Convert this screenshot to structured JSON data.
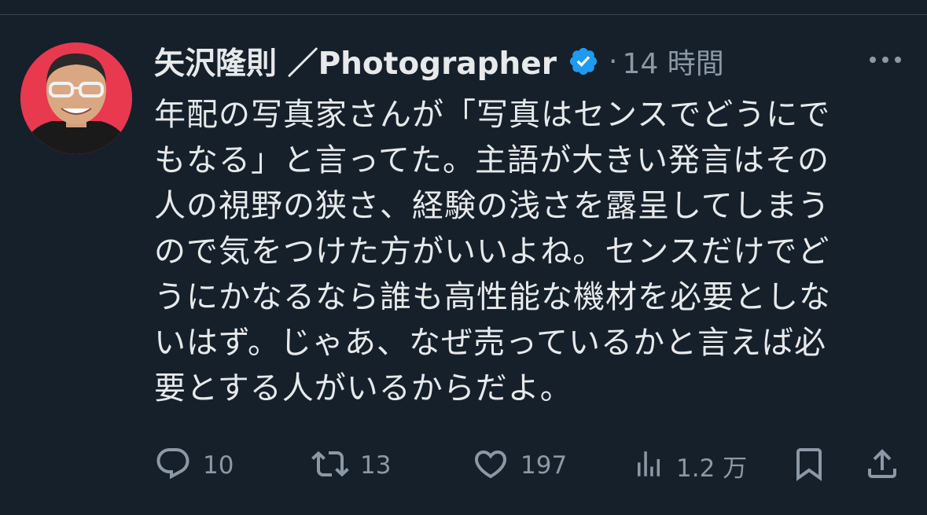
{
  "tweet": {
    "author_name": "矢沢隆則 ／Photographer",
    "separator": "·",
    "time": "14 時間",
    "text": "年配の写真家さんが「写真はセンスでどうにで\nもなる」と言ってた。主語が大きい発言はその\n人の視野の狭さ、経験の浅さを露呈してしまう\nので気をつけた方がいいよね。センスだけでど\nうにかなるなら誰も高性能な機材を必要としな\nいはず。じゃあ、なぜ売っているかと言えば必\n要とする人がいるからだよ。"
  },
  "actions": {
    "replies": "10",
    "retweets": "13",
    "likes": "197",
    "views": "1.2 万"
  },
  "colors": {
    "background": "#15202b",
    "text": "#e7e9ea",
    "muted": "#8b98a5",
    "verified": "#1d9bf0",
    "avatar_bg": "#e8394f"
  },
  "icons": [
    "verified-badge-icon",
    "more-icon",
    "reply-icon",
    "retweet-icon",
    "like-icon",
    "views-icon",
    "bookmark-icon",
    "share-icon"
  ]
}
